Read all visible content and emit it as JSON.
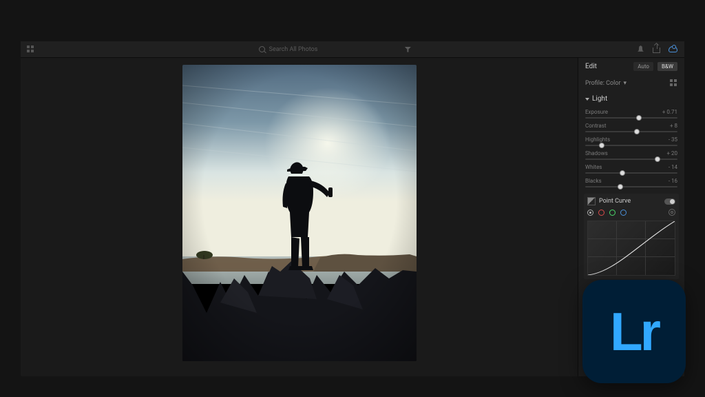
{
  "logo_text": "Lr",
  "topbar": {
    "search_placeholder": "Search All Photos"
  },
  "panel": {
    "title": "Edit",
    "auto_label": "Auto",
    "bw_label": "B&W",
    "profile_label": "Profile: Color",
    "light_section": "Light",
    "sliders": [
      {
        "label": "Exposure",
        "value": "+ 0.71",
        "pos": 58
      },
      {
        "label": "Contrast",
        "value": "+ 8",
        "pos": 56
      },
      {
        "label": "Highlights",
        "value": "- 35",
        "pos": 18
      },
      {
        "label": "Shadows",
        "value": "+ 20",
        "pos": 78
      },
      {
        "label": "Whites",
        "value": "- 14",
        "pos": 40
      },
      {
        "label": "Blacks",
        "value": "- 16",
        "pos": 38
      }
    ],
    "curve_label": "Point Curve"
  }
}
